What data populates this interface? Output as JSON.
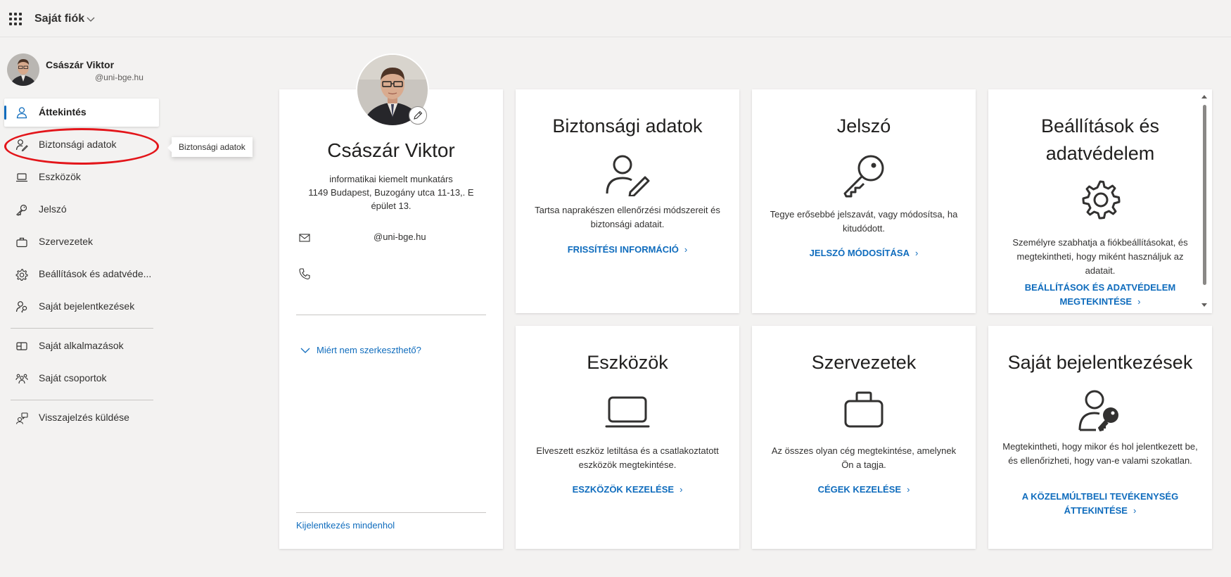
{
  "header": {
    "app_title": "Saját fiók"
  },
  "user": {
    "name": "Császár Viktor",
    "email": "@uni-bge.hu"
  },
  "sidebar": {
    "items": [
      {
        "label": "Áttekintés",
        "icon": "person-icon"
      },
      {
        "label": "Biztonsági adatok",
        "icon": "security-info-icon"
      },
      {
        "label": "Eszközök",
        "icon": "laptop-icon"
      },
      {
        "label": "Jelszó",
        "icon": "key-icon"
      },
      {
        "label": "Szervezetek",
        "icon": "briefcase-icon"
      },
      {
        "label": "Beállítások és adatvéde...",
        "icon": "gear-icon"
      },
      {
        "label": "Saját bejelentkezések",
        "icon": "sign-ins-icon"
      },
      {
        "label": "Saját alkalmazások",
        "icon": "apps-icon"
      },
      {
        "label": "Saját csoportok",
        "icon": "groups-icon"
      },
      {
        "label": "Visszajelzés küldése",
        "icon": "feedback-icon"
      }
    ],
    "tooltip": "Biztonsági adatok"
  },
  "profile": {
    "name": "Császár Viktor",
    "job_title": "informatikai kiemelt munkatárs",
    "address": "1149 Budapest, Buzogány utca 11-13,. E épület 13.",
    "email": "@uni-bge.hu",
    "phone": "",
    "why_not_editable": "Miért nem szerkeszthető?",
    "sign_out_everywhere": "Kijelentkezés mindenhol"
  },
  "tiles": [
    {
      "title": "Biztonsági adatok",
      "desc": "Tartsa naprakészen ellenőrzési módszereit és biztonsági adatait.",
      "link": "FRISSÍTÉSI INFORMÁCIÓ",
      "icon": "security-info-icon"
    },
    {
      "title": "Jelszó",
      "desc": "Tegye erősebbé jelszavát, vagy módosítsa, ha kitudódott.",
      "link": "JELSZÓ MÓDOSÍTÁSA",
      "icon": "key-icon"
    },
    {
      "title": "Beállítások és adatvédelem",
      "desc": "Személyre szabhatja a fiókbeállításokat, és megtekintheti, hogy miként használjuk az adatait.",
      "link": "BEÁLLÍTÁSOK ÉS ADATVÉDELEM MEGTEKINTÉSE",
      "icon": "gear-icon"
    },
    {
      "title": "Eszközök",
      "desc": "Elveszett eszköz letiltása és a csatlakoztatott eszközök megtekintése.",
      "link": "ESZKÖZÖK KEZELÉSE",
      "icon": "laptop-icon"
    },
    {
      "title": "Szervezetek",
      "desc": "Az összes olyan cég megtekintése, amelynek Ön a tagja.",
      "link": "CÉGEK KEZELÉSE",
      "icon": "briefcase-icon"
    },
    {
      "title": "Saját bejelentkezések",
      "desc": "Megtekintheti, hogy mikor és hol jelentkezett be, és ellenőrizheti, hogy van-e valami szokatlan.",
      "link": "A KÖZELMÚLTBELI TEVÉKENYSÉG ÁTTEKINTÉSE",
      "icon": "sign-ins-icon"
    }
  ],
  "colors": {
    "accent": "#0f6cbd",
    "highlight": "#e3151a",
    "background": "#f3f2f1"
  }
}
